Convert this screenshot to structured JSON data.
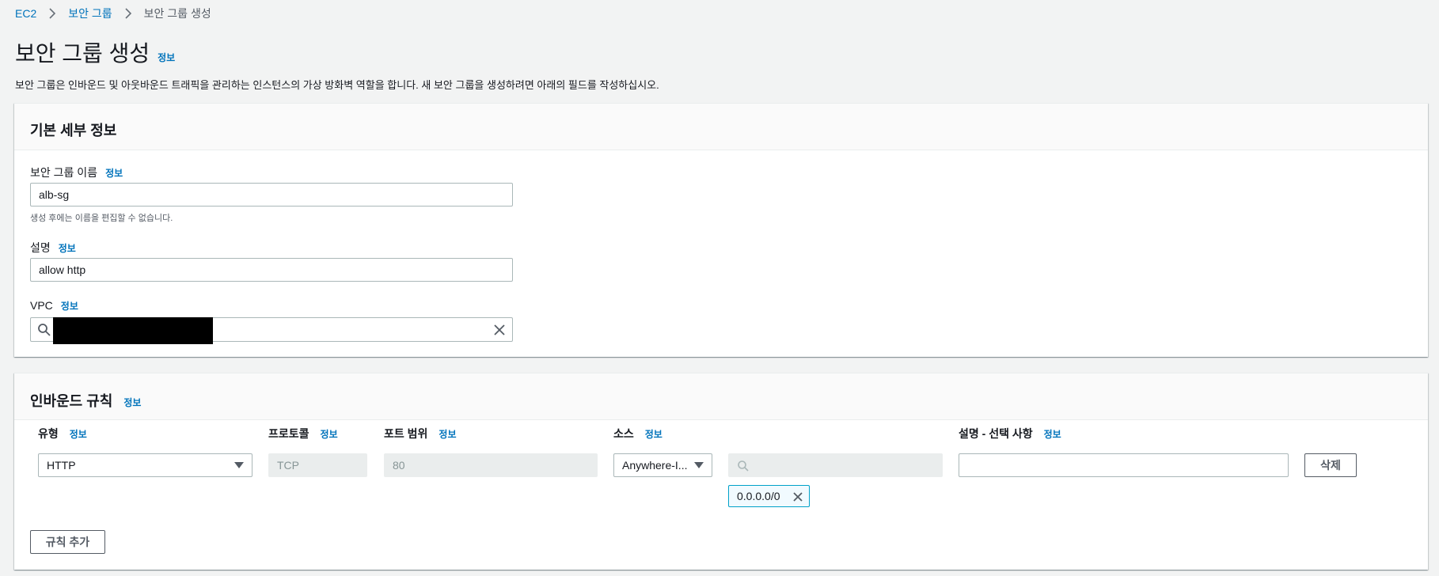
{
  "breadcrumb": {
    "items": [
      "EC2",
      "보안 그룹"
    ],
    "current": "보안 그룹 생성"
  },
  "page": {
    "title": "보안 그룹 생성",
    "info": "정보",
    "description": "보안 그룹은 인바운드 및 아웃바운드 트래픽을 관리하는 인스턴스의 가상 방화벽 역할을 합니다. 새 보안 그룹을 생성하려면 아래의 필드를 작성하십시오."
  },
  "basic": {
    "title": "기본 세부 정보",
    "name_label": "보안 그룹 이름",
    "name_info": "정보",
    "name_value": "alb-sg",
    "name_hint": "생성 후에는 이름을 편집할 수 없습니다.",
    "desc_label": "설명",
    "desc_info": "정보",
    "desc_value": "allow http",
    "vpc_label": "VPC",
    "vpc_info": "정보"
  },
  "inbound": {
    "title": "인바운드 규칙",
    "info": "정보",
    "columns": {
      "type": "유형",
      "protocol": "프로토콜",
      "port": "포트 범위",
      "source": "소스",
      "description": "설명 - 선택 사항",
      "info": "정보"
    },
    "rule": {
      "type": "HTTP",
      "protocol": "TCP",
      "port": "80",
      "source": "Anywhere-I...",
      "cidr": "0.0.0.0/0",
      "description": ""
    },
    "delete_label": "삭제",
    "add_rule_label": "규칙 추가"
  },
  "colors": {
    "link": "#0073bb",
    "background": "#f2f3f3",
    "token_border": "#00a1c9"
  }
}
